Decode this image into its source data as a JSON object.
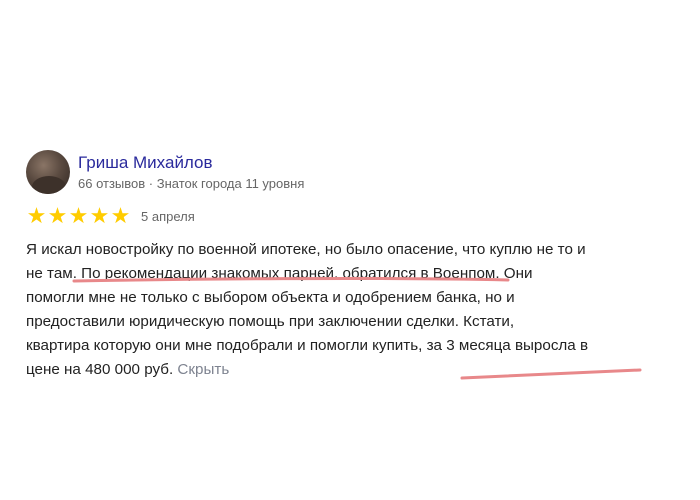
{
  "review": {
    "author_name": "Гриша Михайлов",
    "author_meta": "66 отзывов · Знаток города 11 уровня",
    "rating": 5,
    "date": "5 апреля",
    "text_lines": [
      "Я искал новостройку по военной ипотеке, но было опасение, что куплю не то и",
      "не там. По рекомендации знакомых парней, обратился в Военпом. Они",
      "помогли мне не только с выбором объекта и одобрением банка, но и",
      "предоставили юридическую помощь при заключении сделки. Кстати,",
      "квартира которую они мне подобрали и помогли купить, за 3 месяца выросла в",
      "цене на 480 000 руб."
    ],
    "hide_label": "Скрыть"
  },
  "colors": {
    "author_link": "#2a2a9c",
    "star": "#ffcc00",
    "underline_marks": "#e8888a"
  },
  "icons": [
    "avatar",
    "star-icon"
  ]
}
